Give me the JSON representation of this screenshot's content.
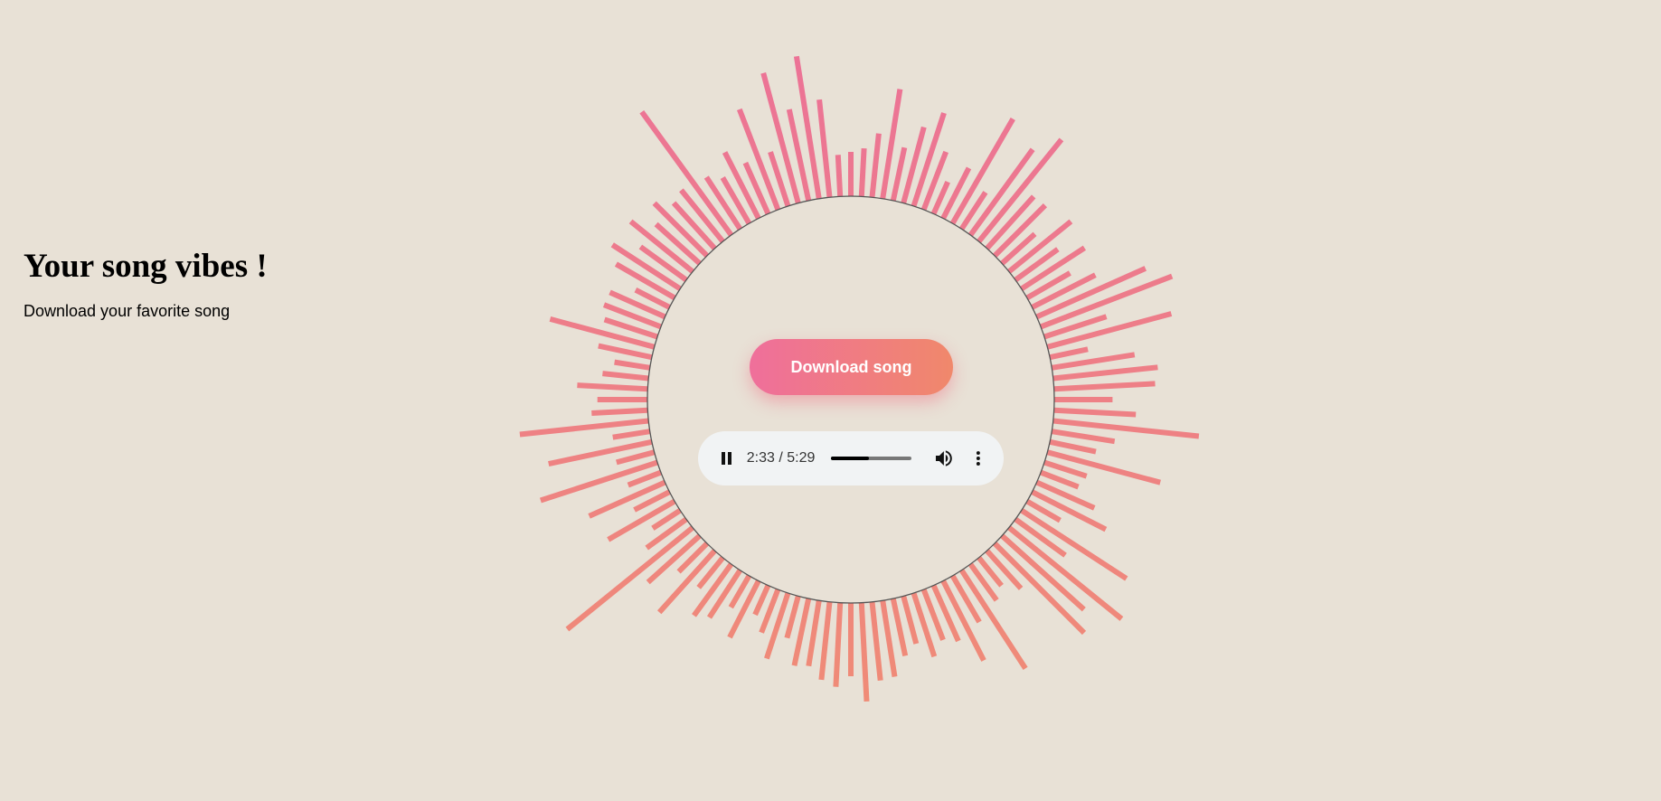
{
  "hero": {
    "title": "Your song vibes !",
    "subtitle": "Download your favorite song"
  },
  "download_button": {
    "label": "Download song"
  },
  "player": {
    "time_display": "2:33 / 5:29",
    "progress_fraction": 0.465,
    "play_state": "playing",
    "pause_icon": "pause-icon",
    "volume_icon": "volume-icon",
    "more_icon": "more-vertical-icon"
  },
  "visualizer": {
    "bar_count": 120,
    "gradient_top": "#ec7396",
    "gradient_bottom": "#f08f72",
    "ring_color": "#555555"
  },
  "colors": {
    "background": "#e8e1d6",
    "button_start": "#ef6f9b",
    "button_end": "#f0886b",
    "player_bg": "#f1f3f4"
  }
}
